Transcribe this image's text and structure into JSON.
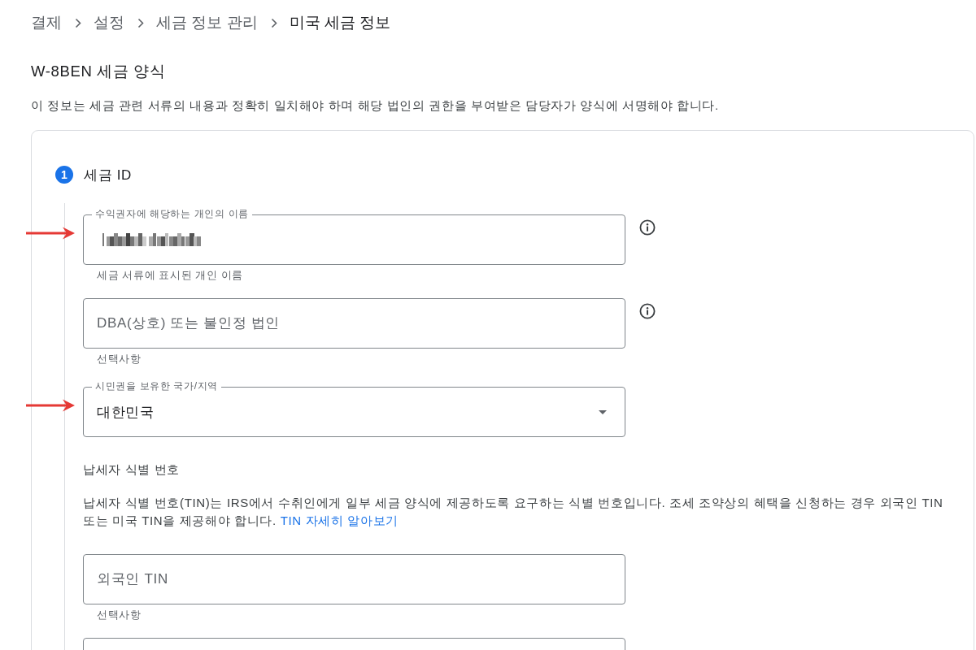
{
  "breadcrumb": [
    {
      "label": "결제",
      "current": false
    },
    {
      "label": "설정",
      "current": false
    },
    {
      "label": "세금 정보 관리",
      "current": false
    },
    {
      "label": "미국 세금 정보",
      "current": true
    }
  ],
  "form": {
    "title": "W-8BEN 세금 양식",
    "description": "이 정보는 세금 관련 서류의 내용과 정확히 일치해야 하며 해당 법인의 권한을 부여받은 담당자가 양식에 서명해야 합니다."
  },
  "steps": [
    {
      "number": "1",
      "title": "세금 ID",
      "active": true,
      "items": [
        {
          "kind": "input",
          "label": "수익권자에 해당하는 개인의 이름",
          "value_redacted": true,
          "helper": "세금 서류에 표시된 개인 이름",
          "info": true,
          "marked": true
        },
        {
          "kind": "input",
          "placeholder": "DBA(상호) 또는 불인정 법인",
          "value_redacted": false,
          "helper": "선택사항",
          "info": true,
          "marked": false
        },
        {
          "kind": "select",
          "label": "시민권을 보유한 국가/지역",
          "value": "대한민국",
          "info": false,
          "marked": true
        },
        {
          "kind": "heading",
          "text": "납세자 식별 번호"
        },
        {
          "kind": "paragraph",
          "text": "납세자 식별 번호(TIN)는 IRS에서 수취인에게 일부 세금 양식에 제공하도록 요구하는 식별 번호입니다. 조세 조약상의 혜택을 신청하는 경우 외국인 TIN 또는 미국 TIN을 제공해야 합니다.",
          "link": "TIN 자세히 알아보기"
        },
        {
          "kind": "input",
          "placeholder": "외국인 TIN",
          "value_redacted": false,
          "helper": "선택사항",
          "info": false,
          "marked": false
        },
        {
          "kind": "input",
          "value_redacted": false,
          "info": false,
          "marked": false
        }
      ]
    }
  ]
}
